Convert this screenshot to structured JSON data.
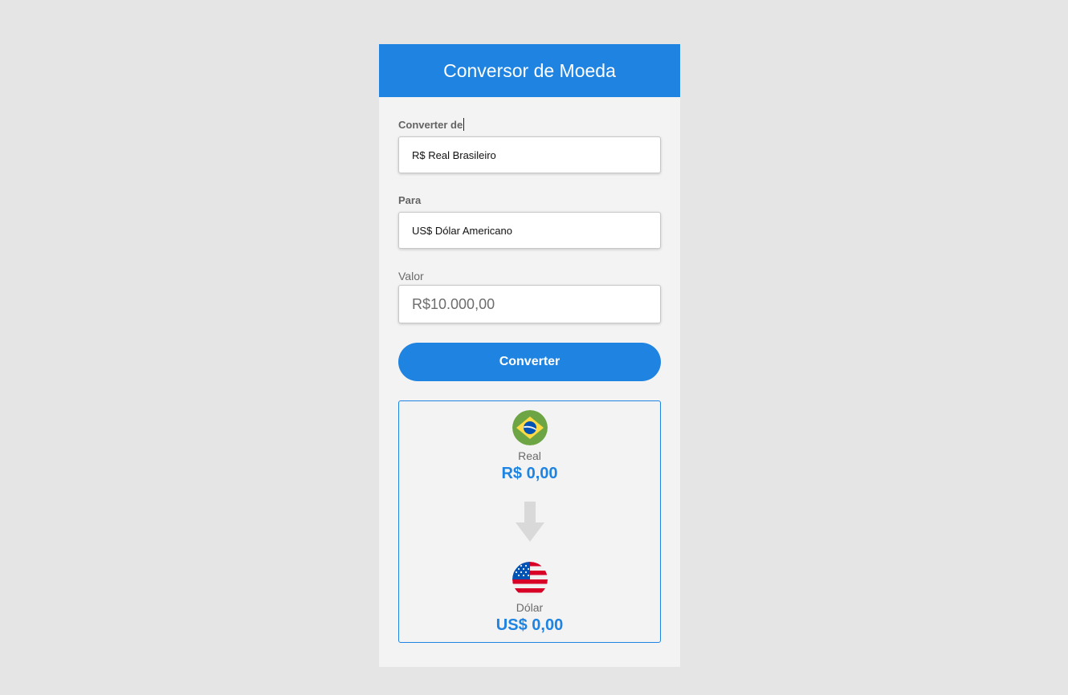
{
  "header": {
    "title": "Conversor de Moeda"
  },
  "form": {
    "from_label": "Converter de",
    "from_value": "R$ Real Brasileiro",
    "to_label": "Para",
    "to_value": "US$ Dólar Americano",
    "value_label": "Valor",
    "value_placeholder": "R$10.000,00",
    "convert_button": "Converter"
  },
  "result": {
    "from": {
      "icon": "brazil-flag-icon",
      "name": "Real",
      "amount": "R$ 0,00"
    },
    "arrow_icon": "arrow-down-icon",
    "to": {
      "icon": "usa-flag-icon",
      "name": "Dólar",
      "amount": "US$ 0,00"
    }
  },
  "colors": {
    "accent": "#1e83e1",
    "background": "#e5e5e5",
    "card": "#f3f3f3"
  }
}
